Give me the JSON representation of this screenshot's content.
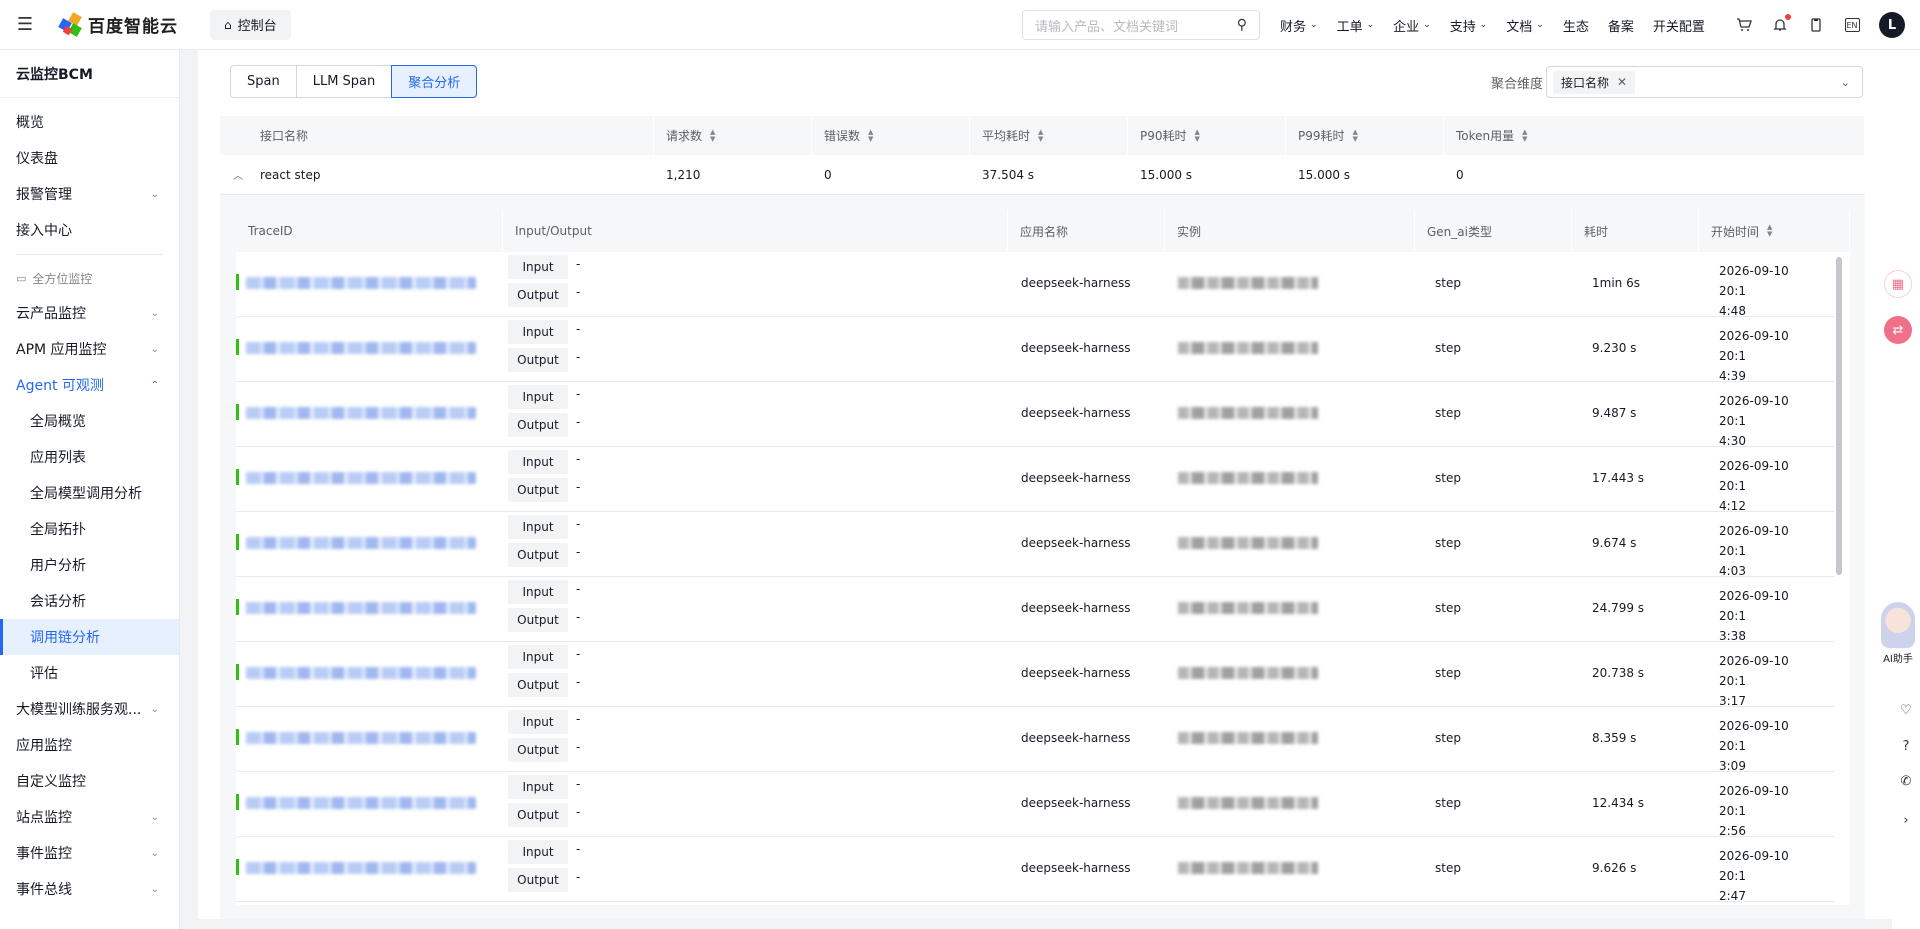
{
  "topbar": {
    "brand": "百度智能云",
    "console_label": "控制台",
    "search_placeholder": "请输入产品、文档关键词",
    "nav": [
      "财务",
      "工单",
      "企业",
      "支持",
      "文档",
      "生态",
      "备案",
      "开关配置"
    ],
    "nav_has_dropdown": [
      true,
      true,
      true,
      true,
      true,
      false,
      false,
      false
    ],
    "lang": "EN",
    "avatar_initial": "L"
  },
  "sidebar": {
    "title": "云监控BCM",
    "items_top": [
      {
        "label": "概览"
      },
      {
        "label": "仪表盘"
      },
      {
        "label": "报警管理",
        "arrow": "⌄"
      },
      {
        "label": "接入中心"
      }
    ],
    "group_label": "全方位监控",
    "items_mid": [
      {
        "label": "云产品监控",
        "arrow": "⌄"
      },
      {
        "label": "APM 应用监控",
        "arrow": "⌄"
      },
      {
        "label": "Agent 可观测",
        "arrow": "⌃"
      }
    ],
    "sub_items": [
      "全局概览",
      "应用列表",
      "全局模型调用分析",
      "全局拓扑",
      "用户分析",
      "会话分析",
      "调用链分析",
      "评估"
    ],
    "active_sub": "调用链分析",
    "items_bottom": [
      {
        "label": "大模型训练服务观...",
        "arrow": "⌄"
      },
      {
        "label": "应用监控"
      },
      {
        "label": "自定义监控"
      },
      {
        "label": "站点监控",
        "arrow": "⌄"
      },
      {
        "label": "事件监控",
        "arrow": "⌄"
      },
      {
        "label": "事件总线",
        "arrow": "⌄"
      }
    ]
  },
  "main": {
    "tabs": [
      "Span",
      "LLM Span",
      "聚合分析"
    ],
    "active_tab": "聚合分析",
    "agg_label": "聚合维度",
    "agg_tag": "接口名称",
    "outer_columns": [
      "接口名称",
      "请求数",
      "错误数",
      "平均耗时",
      "P90耗时",
      "P99耗时",
      "Token用量"
    ],
    "outer_row": [
      "react step",
      "1,210",
      "0",
      "37.504 s",
      "15.000 s",
      "15.000 s",
      "0"
    ],
    "inner_columns": [
      "TraceID",
      "Input/Output",
      "应用名称",
      "实例",
      "Gen_ai类型",
      "耗时",
      "开始时间"
    ],
    "io_labels": {
      "input": "Input",
      "output": "Output",
      "empty": "-"
    },
    "rows": [
      {
        "app": "deepseek-harness",
        "gen": "step",
        "duration": "1min 6s",
        "start_a": "2026-09-10 20:1",
        "start_b": "4:48"
      },
      {
        "app": "deepseek-harness",
        "gen": "step",
        "duration": "9.230 s",
        "start_a": "2026-09-10 20:1",
        "start_b": "4:39"
      },
      {
        "app": "deepseek-harness",
        "gen": "step",
        "duration": "9.487 s",
        "start_a": "2026-09-10 20:1",
        "start_b": "4:30"
      },
      {
        "app": "deepseek-harness",
        "gen": "step",
        "duration": "17.443 s",
        "start_a": "2026-09-10 20:1",
        "start_b": "4:12"
      },
      {
        "app": "deepseek-harness",
        "gen": "step",
        "duration": "9.674 s",
        "start_a": "2026-09-10 20:1",
        "start_b": "4:03"
      },
      {
        "app": "deepseek-harness",
        "gen": "step",
        "duration": "24.799 s",
        "start_a": "2026-09-10 20:1",
        "start_b": "3:38"
      },
      {
        "app": "deepseek-harness",
        "gen": "step",
        "duration": "20.738 s",
        "start_a": "2026-09-10 20:1",
        "start_b": "3:17"
      },
      {
        "app": "deepseek-harness",
        "gen": "step",
        "duration": "8.359 s",
        "start_a": "2026-09-10 20:1",
        "start_b": "3:09"
      },
      {
        "app": "deepseek-harness",
        "gen": "step",
        "duration": "12.434 s",
        "start_a": "2026-09-10 20:1",
        "start_b": "2:56"
      },
      {
        "app": "deepseek-harness",
        "gen": "step",
        "duration": "9.626 s",
        "start_a": "2026-09-10 20:1",
        "start_b": "2:47"
      }
    ]
  },
  "ai_helper_label": "AI助手",
  "colors": {
    "accent": "#2468f2",
    "status_ok": "#30bf13",
    "active_bg": "#e6f0ff"
  }
}
